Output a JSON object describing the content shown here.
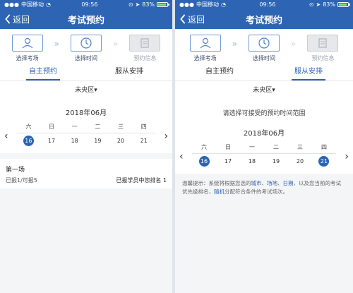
{
  "left": {
    "status": {
      "carrier": "中国移动",
      "time": "09:56",
      "battery": "83%"
    },
    "nav": {
      "back": "返回",
      "title": "考试预约"
    },
    "steps": [
      {
        "label": "选择考场",
        "icon": "user-icon",
        "state": "active"
      },
      {
        "label": "选择时间",
        "icon": "clock-icon",
        "state": "active"
      },
      {
        "label": "预约信息",
        "icon": "document-icon",
        "state": "disabled"
      }
    ],
    "tabs": [
      {
        "label": "自主预约",
        "active": true
      },
      {
        "label": "服从安排",
        "active": false
      }
    ],
    "district": "未央区▾",
    "calendar": {
      "month": "2018年06月",
      "weekdays": [
        "六",
        "日",
        "一",
        "二",
        "三",
        "四"
      ],
      "days": [
        "16",
        "17",
        "18",
        "19",
        "20",
        "21"
      ],
      "selected": [
        0
      ]
    },
    "session": {
      "title": "第一场",
      "quota": "已报1/可报5",
      "rank_label": "已报学员中您排名",
      "rank_value": "1"
    }
  },
  "right": {
    "status": {
      "carrier": "中国移动",
      "time": "09:56",
      "battery": "83%"
    },
    "nav": {
      "back": "返回",
      "title": "考试预约"
    },
    "steps": [
      {
        "label": "选择考场",
        "icon": "user-icon",
        "state": "active"
      },
      {
        "label": "选择时间",
        "icon": "clock-icon",
        "state": "active"
      },
      {
        "label": "预约信息",
        "icon": "document-icon",
        "state": "disabled"
      }
    ],
    "tabs": [
      {
        "label": "自主预约",
        "active": false
      },
      {
        "label": "服从安排",
        "active": true
      }
    ],
    "district": "未央区▾",
    "prompt": "请选择可接受的预约时间范围",
    "calendar": {
      "month": "2018年06月",
      "weekdays": [
        "六",
        "日",
        "一",
        "二",
        "三",
        "四"
      ],
      "days": [
        "16",
        "17",
        "18",
        "19",
        "20",
        "21"
      ],
      "selected": [
        0,
        5
      ]
    },
    "tip": {
      "p1": "温馨提示：系统将根据您选的",
      "kw1": "城市",
      "s1": "、",
      "kw2": "场地",
      "s2": "、",
      "kw3": "日期",
      "p2": "，以及您当前的考试优先级排名，",
      "kw4": "随机",
      "p3": "分配符合条件的考试场次。"
    }
  }
}
